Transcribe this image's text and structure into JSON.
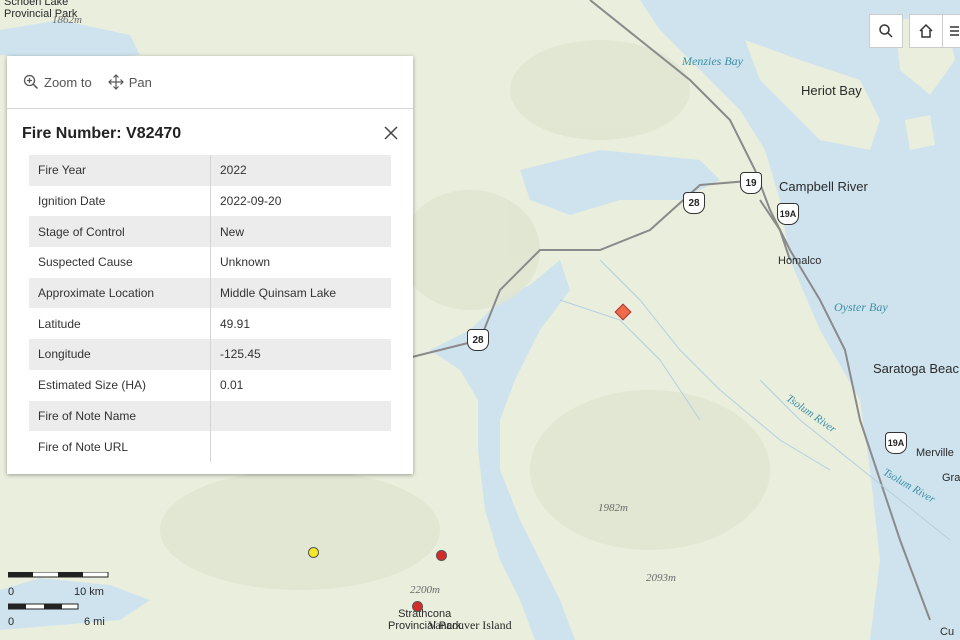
{
  "map": {
    "place_labels": {
      "strathcona_top": "Schoen Lake\nProvincial Park",
      "heriot_bay": "Heriot Bay",
      "campbell_river": "Campbell River",
      "homalco": "Homalco",
      "saratoga_beach": "Saratoga Beac",
      "merville": "Merville",
      "gra": "Gra",
      "cu": "Cu",
      "strathcona_bottom": "Strathcona\nProvincial Park",
      "vancouver_island": "Vancouver Island"
    },
    "water_labels": {
      "menzies_bay": "Menzies Bay",
      "oyster_bay": "Oyster Bay",
      "tsolum_river_1": "Tsolum River",
      "tsolum_river_2": "Tsolum River"
    },
    "elevations": {
      "e1862": "1862m",
      "e1982": "1982m",
      "e2093": "2093m",
      "e2200": "2200m"
    },
    "highway_shields": {
      "hwy19": "19",
      "hwy28a": "28",
      "hwy19a": "19A",
      "hwy28b": "28",
      "hwy19a_south": "19A"
    },
    "scale": {
      "km_label": "10 km",
      "mi_label": "6 mi",
      "zero_label": "0",
      "zero_label2": "0"
    },
    "colors": {
      "land": "#e9eedd",
      "water": "#cfe3ee",
      "road": "#8a8a8a",
      "fire_marker": "#ef6b4a",
      "fire_red": "#d62b2b",
      "fire_yellow": "#f5e829"
    }
  },
  "controls": {
    "search_icon": "search-icon",
    "home_icon": "home-icon",
    "list_icon": "list-icon"
  },
  "popup": {
    "actions": {
      "zoom_label": "Zoom to",
      "pan_label": "Pan"
    },
    "title": "Fire Number: V82470",
    "attributes": [
      {
        "key": "Fire Year",
        "value": "2022"
      },
      {
        "key": "Ignition Date",
        "value": "2022-09-20"
      },
      {
        "key": "Stage of Control",
        "value": "New"
      },
      {
        "key": "Suspected Cause",
        "value": "Unknown"
      },
      {
        "key": "Approximate Location",
        "value": "Middle Quinsam Lake"
      },
      {
        "key": "Latitude",
        "value": "49.91"
      },
      {
        "key": "Longitude",
        "value": "-125.45"
      },
      {
        "key": "Estimated Size (HA)",
        "value": "0.01"
      },
      {
        "key": "Fire of Note Name",
        "value": ""
      },
      {
        "key": "Fire of Note URL",
        "value": ""
      }
    ]
  }
}
